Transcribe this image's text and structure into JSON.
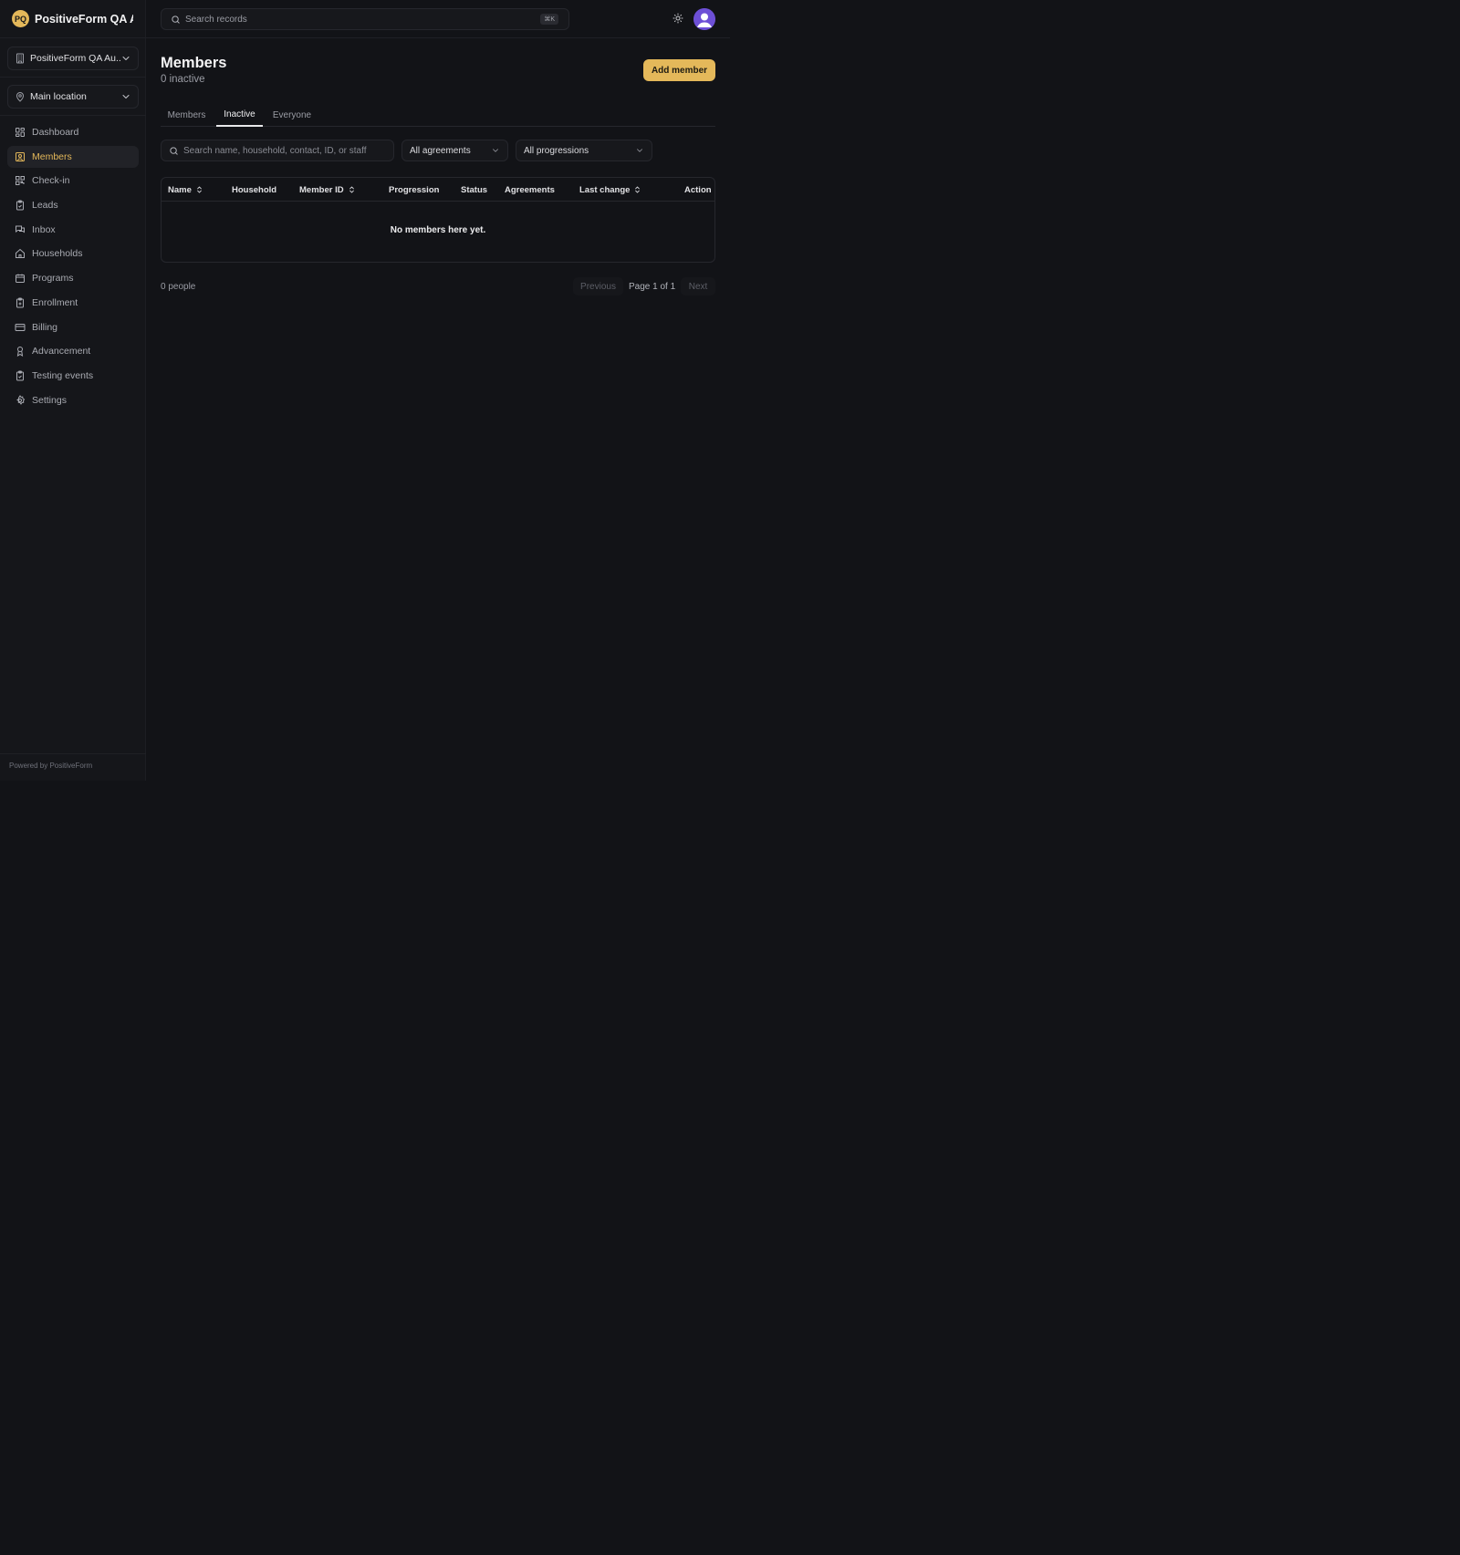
{
  "brand": {
    "logo_initials": "PQ",
    "name": "PositiveForm QA A...",
    "logo_color": "#e4b85a"
  },
  "org_selector": {
    "value": "PositiveForm QA Au...",
    "icon": "building-icon"
  },
  "location_selector": {
    "value": "Main location",
    "icon": "map-pin-icon"
  },
  "sidebar": {
    "items": [
      {
        "label": "Dashboard",
        "icon": "dashboard-icon",
        "active": false
      },
      {
        "label": "Members",
        "icon": "members-icon",
        "active": true
      },
      {
        "label": "Check-in",
        "icon": "qr-code-icon",
        "active": false
      },
      {
        "label": "Leads",
        "icon": "clipboard-icon",
        "active": false
      },
      {
        "label": "Inbox",
        "icon": "chat-icon",
        "active": false
      },
      {
        "label": "Households",
        "icon": "home-icon",
        "active": false
      },
      {
        "label": "Programs",
        "icon": "calendar-icon",
        "active": false
      },
      {
        "label": "Enrollment",
        "icon": "clipboard-plus-icon",
        "active": false
      },
      {
        "label": "Billing",
        "icon": "credit-card-icon",
        "active": false
      },
      {
        "label": "Advancement",
        "icon": "award-icon",
        "active": false
      },
      {
        "label": "Testing events",
        "icon": "clipboard-check-icon",
        "active": false
      },
      {
        "label": "Settings",
        "icon": "gear-icon",
        "active": false
      }
    ],
    "footer": "Powered by PositiveForm"
  },
  "topbar": {
    "search_placeholder": "Search records",
    "shortcut": "⌘K",
    "theme_icon": "sun-icon",
    "avatar_color": "#6d4fd6"
  },
  "page": {
    "title": "Members",
    "subtitle": "0 inactive",
    "add_button": "Add member",
    "accent": "#e4b85a"
  },
  "tabs": [
    {
      "label": "Members",
      "active": false
    },
    {
      "label": "Inactive",
      "active": true
    },
    {
      "label": "Everyone",
      "active": false
    }
  ],
  "filters": {
    "search_placeholder": "Search name, household, contact, ID, or staff",
    "agreements": "All agreements",
    "progressions": "All progressions"
  },
  "table": {
    "columns": [
      "Name",
      "Household",
      "Member ID",
      "Progression",
      "Status",
      "Agreements",
      "Last change",
      "Action"
    ],
    "empty_message": "No members here yet."
  },
  "footer": {
    "count": "0 people",
    "previous": "Previous",
    "page_info": "Page 1 of 1",
    "next": "Next"
  }
}
